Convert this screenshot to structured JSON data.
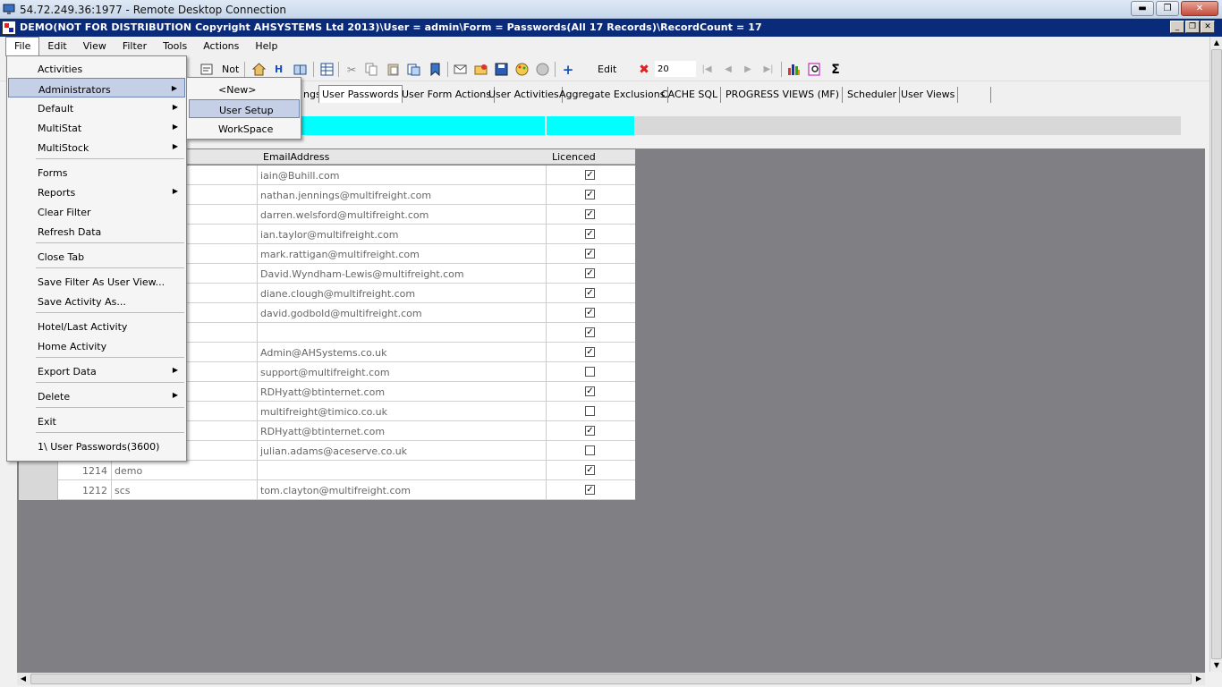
{
  "rdc": {
    "title": "54.72.249.36:1977 - Remote Desktop Connection"
  },
  "app": {
    "title": "DEMO(NOT FOR DISTRIBUTION Copyright AHSYSTEMS Ltd 2013)\\User = admin\\Form = Passwords(All 17 Records)\\RecordCount = 17"
  },
  "menu": [
    "File",
    "Edit",
    "View",
    "Filter",
    "Tools",
    "Actions",
    "Help"
  ],
  "toolbar": {
    "not_label": "Not",
    "h_label": "H",
    "edit_label": "Edit",
    "page_size": "20"
  },
  "tabs": [
    {
      "label": "ngs"
    },
    {
      "label": "User Passwords"
    },
    {
      "label": "User Form Actions"
    },
    {
      "label": "User Activities"
    },
    {
      "label": "Aggregate Exclusions"
    },
    {
      "label": "CACHE SQL"
    },
    {
      "label": "PROGRESS VIEWS (MF)"
    },
    {
      "label": "Scheduler"
    },
    {
      "label": "User Views"
    }
  ],
  "grid": {
    "headers": {
      "email": "EmailAddress",
      "licenced": "Licenced"
    },
    "rows": [
      {
        "id": "",
        "name": "",
        "email": "iain@Buhill.com",
        "licenced": true
      },
      {
        "id": "",
        "name": "",
        "email": "nathan.jennings@multifreight.com",
        "licenced": true
      },
      {
        "id": "",
        "name": "",
        "email": "darren.welsford@multifreight.com",
        "licenced": true
      },
      {
        "id": "",
        "name": "",
        "email": "ian.taylor@multifreight.com",
        "licenced": true
      },
      {
        "id": "",
        "name": "",
        "email": "mark.rattigan@multifreight.com",
        "licenced": true
      },
      {
        "id": "",
        "name": "",
        "email": "David.Wyndham-Lewis@multifreight.com",
        "licenced": true
      },
      {
        "id": "",
        "name": "",
        "email": "diane.clough@multifreight.com",
        "licenced": true
      },
      {
        "id": "",
        "name": "",
        "email": "david.godbold@multifreight.com",
        "licenced": true
      },
      {
        "id": "",
        "name": "",
        "email": "",
        "licenced": true
      },
      {
        "id": "",
        "name": "",
        "email": "Admin@AHSystems.co.uk",
        "licenced": true
      },
      {
        "id": "",
        "name": "",
        "email": "support@multifreight.com",
        "licenced": false
      },
      {
        "id": "",
        "name": "",
        "email": "RDHyatt@btinternet.com",
        "licenced": true
      },
      {
        "id": "",
        "name": "",
        "email": "multifreight@timico.co.uk",
        "licenced": false
      },
      {
        "id": "",
        "name": "",
        "email": "RDHyatt@btinternet.com",
        "licenced": true
      },
      {
        "id": "",
        "name": "",
        "email": "julian.adams@aceserve.co.uk",
        "licenced": false
      },
      {
        "id": "1214",
        "name": "demo",
        "email": "",
        "licenced": true
      },
      {
        "id": "1212",
        "name": "scs",
        "email": "tom.clayton@multifreight.com",
        "licenced": true
      }
    ]
  },
  "file_menu": {
    "items": [
      {
        "label": "Activities"
      },
      {
        "label": "Administrators",
        "sub": true,
        "hl": true
      },
      {
        "label": "Default",
        "sub": true
      },
      {
        "label": "MultiStat",
        "sub": true
      },
      {
        "label": "MultiStock",
        "sub": true
      },
      {
        "sep": true
      },
      {
        "label": "Forms"
      },
      {
        "label": "Reports",
        "sub": true
      },
      {
        "label": "Clear Filter"
      },
      {
        "label": "Refresh Data"
      },
      {
        "sep": true
      },
      {
        "label": "Close Tab"
      },
      {
        "sep": true
      },
      {
        "label": "Save Filter As User View..."
      },
      {
        "label": "Save Activity As..."
      },
      {
        "sep": true
      },
      {
        "label": "Hotel/Last Activity"
      },
      {
        "label": "Home Activity"
      },
      {
        "sep": true
      },
      {
        "label": "Export Data",
        "sub": true
      },
      {
        "sep": true
      },
      {
        "label": "Delete",
        "sub": true
      },
      {
        "sep": true
      },
      {
        "label": "Exit"
      },
      {
        "sep": true
      },
      {
        "label": "1\\ User Passwords(3600)"
      }
    ]
  },
  "admin_submenu": [
    {
      "label": "<New>"
    },
    {
      "label": "User Setup",
      "hl": true
    },
    {
      "label": "WorkSpace"
    }
  ]
}
